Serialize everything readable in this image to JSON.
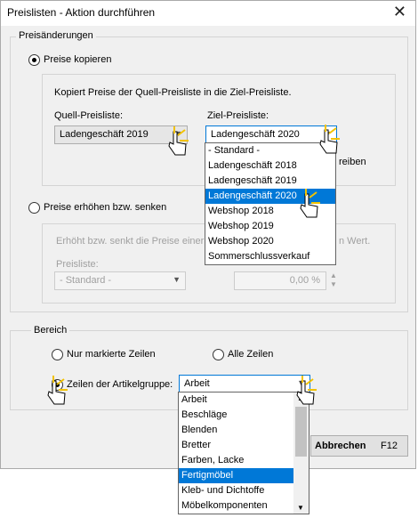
{
  "window": {
    "title": "Preislisten - Aktion durchführen",
    "close_glyph": "✕"
  },
  "price_changes": {
    "group_label": "Preisänderungen",
    "copy": {
      "label": "Preise kopieren",
      "description": "Kopiert Preise der Quell-Preisliste in die Ziel-Preisliste.",
      "source_label": "Quell-Preisliste:",
      "source_value": "Ladengeschäft 2019",
      "target_label": "Ziel-Preisliste:",
      "target_value": "Ladengeschäft 2020",
      "target_options": [
        "- Standard -",
        "Ladengeschäft 2018",
        "Ladengeschäft 2019",
        "Ladengeschäft 2020",
        "Webshop 2018",
        "Webshop 2019",
        "Webshop 2020",
        "Sommerschlussverkauf"
      ],
      "target_selected_index": 3,
      "partial_text": "reiben"
    },
    "adjust": {
      "label": "Preise erhöhen bzw. senken",
      "desc_left": "Erhöht bzw. senkt die Preise einer P",
      "desc_right": "n Wert.",
      "list_label": "Preisliste:",
      "list_value": "- Standard -",
      "percent_value": "0,00 %"
    }
  },
  "range": {
    "group_label": "Bereich",
    "marked_rows_label": "Nur markierte Zeilen",
    "all_rows_label": "Alle Zeilen",
    "group_rows_label": "Zeilen der Artikelgruppe:",
    "group_value": "Arbeit",
    "group_options": [
      "Arbeit",
      "Beschläge",
      "Blenden",
      "Bretter",
      "Farben, Lacke",
      "Fertigmöbel",
      "Kleb- und Dichtoffe",
      "Möbelkomponenten"
    ],
    "group_selected_index": 5
  },
  "footer": {
    "cancel_label": "Abbrechen",
    "cancel_hotkey": "F12"
  }
}
